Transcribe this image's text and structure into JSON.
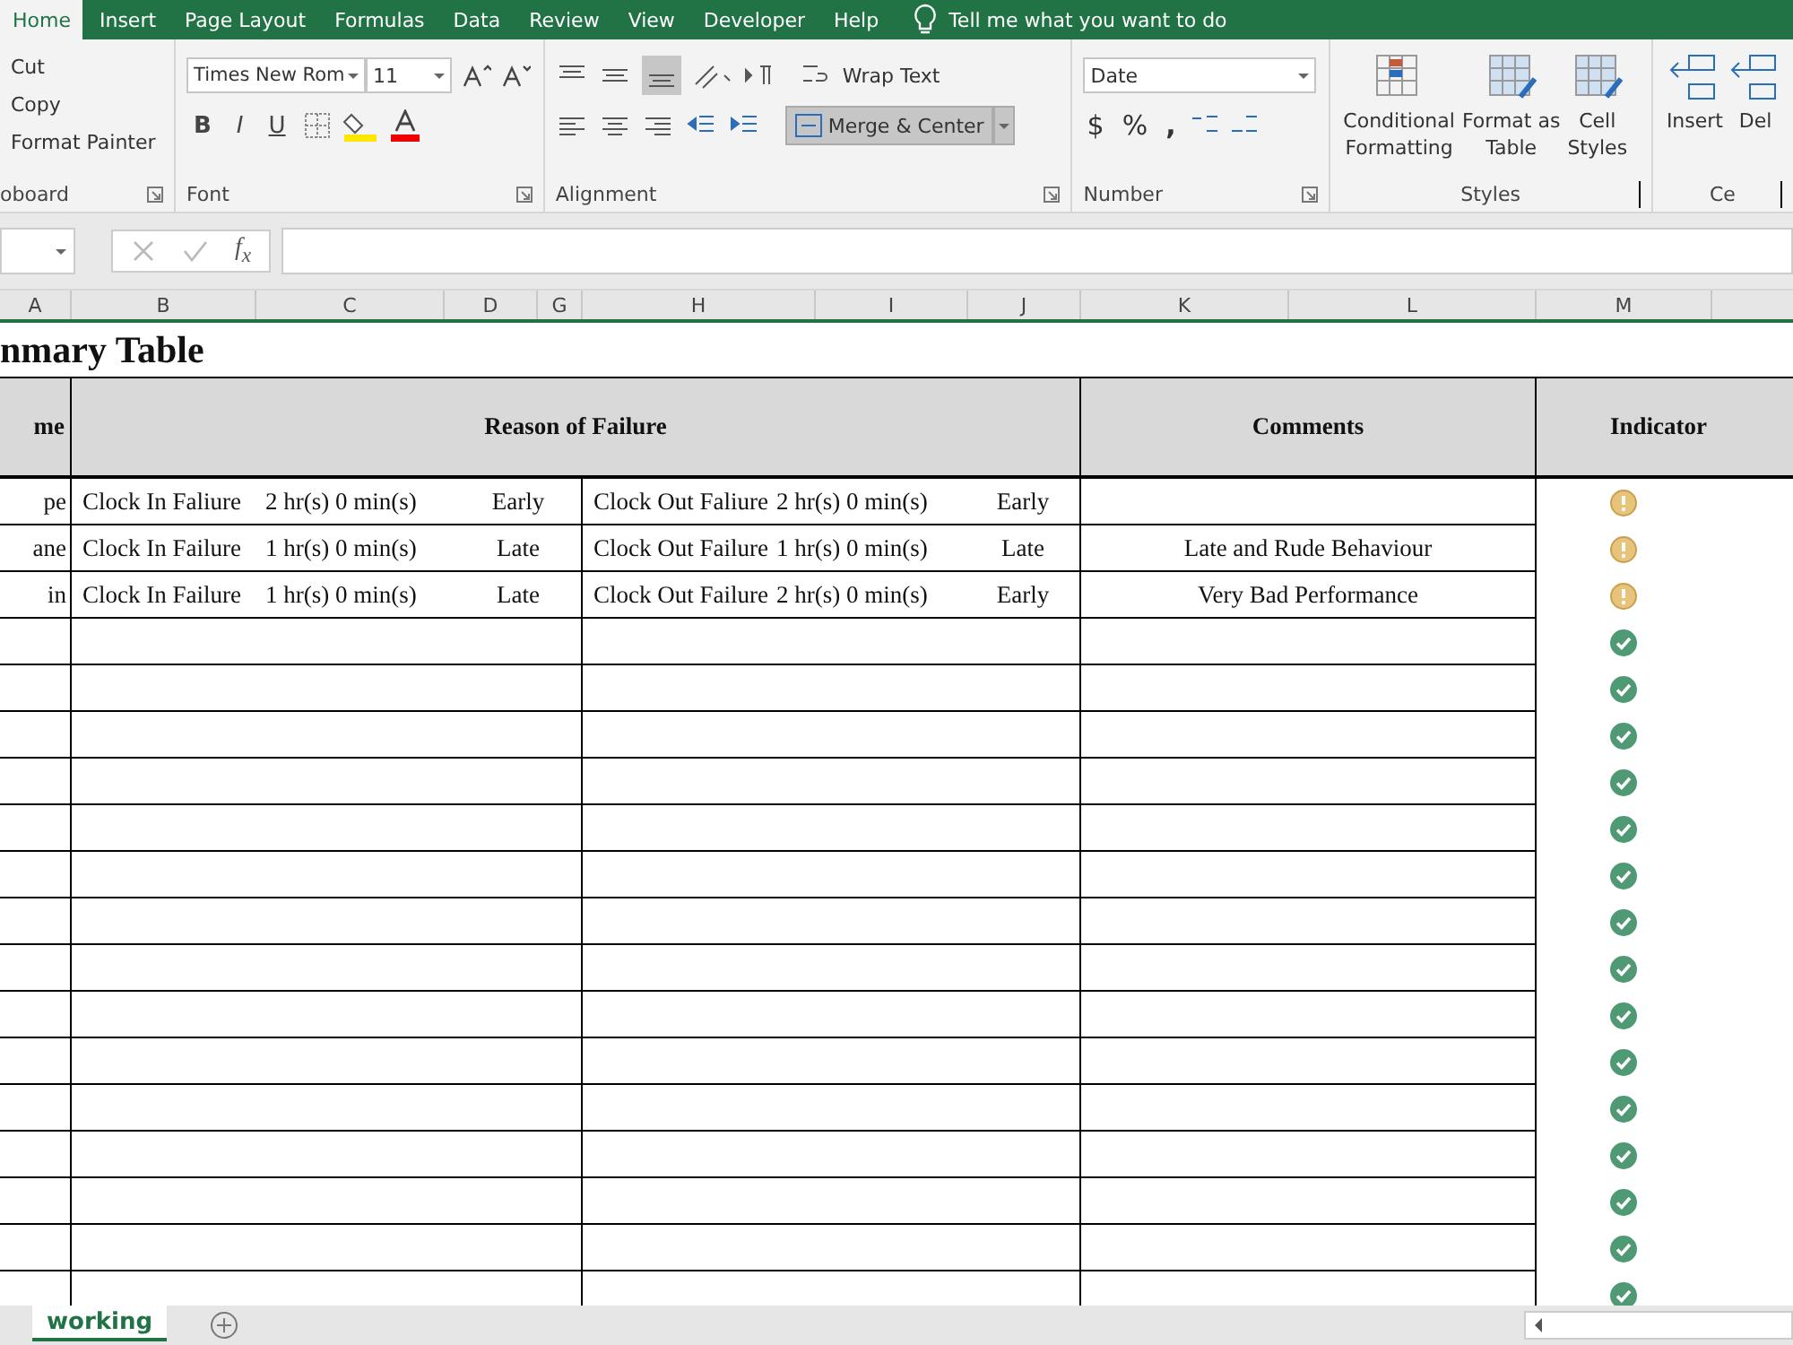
{
  "ribbon_tabs": [
    {
      "label": "Home",
      "selected": true
    },
    {
      "label": "Insert",
      "selected": false
    },
    {
      "label": "Page Layout",
      "selected": false
    },
    {
      "label": "Formulas",
      "selected": false
    },
    {
      "label": "Data",
      "selected": false
    },
    {
      "label": "Review",
      "selected": false
    },
    {
      "label": "View",
      "selected": false
    },
    {
      "label": "Developer",
      "selected": false
    },
    {
      "label": "Help",
      "selected": false
    }
  ],
  "tell_me": "Tell me what you want to do",
  "clipboard": {
    "items": [
      "Cut",
      "Copy",
      "Format Painter"
    ],
    "label": "oboard"
  },
  "font": {
    "family": "Times New Rom",
    "size": "11",
    "bold": "B",
    "italic": "I",
    "underline": "U",
    "label": "Font"
  },
  "alignment": {
    "wrap": "Wrap Text",
    "merge": "Merge & Center",
    "label": "Alignment"
  },
  "number": {
    "format": "Date",
    "currency": "$",
    "percent": "%",
    "comma": ",",
    "label": "Number"
  },
  "styles": {
    "buttons": [
      [
        "Conditional",
        "Formatting"
      ],
      [
        "Format as",
        "Table"
      ],
      [
        "Cell",
        "Styles"
      ]
    ],
    "label": "Styles"
  },
  "cells": {
    "buttons": [
      "Insert",
      "Del"
    ],
    "label": "Ce"
  },
  "formula_bar": {
    "fx": "f$_{x}$"
  },
  "columns": [
    "A",
    "B",
    "C",
    "D",
    "G",
    "H",
    "I",
    "J",
    "K",
    "L",
    "M"
  ],
  "sheet": {
    "title": "nmary Table",
    "headers": [
      "me",
      "Reason of Failure",
      "Comments",
      "Indicator"
    ],
    "rows": [
      {
        "name": "pe",
        "clock_in": [
          "Clock In Faliure",
          "2 hr(s) 0 min(s)",
          "Early"
        ],
        "clock_out": [
          "Clock Out Faliure",
          "2 hr(s) 0 min(s)",
          "Early"
        ],
        "kind": "warning"
      },
      {
        "name": "ane",
        "clock_in": [
          "Clock In Failure",
          "1 hr(s) 0 min(s)",
          "Late"
        ],
        "clock_out": [
          "Clock Out Failure",
          "1 hr(s) 0 min(s)",
          "Late"
        ],
        "comment": "Late and Rude Behaviour",
        "kind": "warning"
      },
      {
        "name": "in",
        "clock_in": [
          "Clock In Failure",
          "1 hr(s) 0 min(s)",
          "Late"
        ],
        "clock_out": [
          "Clock Out Failure",
          "2 hr(s) 0 min(s)",
          "Early"
        ],
        "comment": "Very Bad Performance",
        "kind": "warning"
      },
      {
        "kind": "ok"
      },
      {
        "kind": "ok"
      },
      {
        "kind": "ok"
      },
      {
        "kind": "ok"
      },
      {
        "kind": "ok"
      },
      {
        "kind": "ok"
      },
      {
        "kind": "ok"
      },
      {
        "kind": "ok"
      },
      {
        "kind": "ok"
      },
      {
        "kind": "ok"
      },
      {
        "kind": "ok"
      },
      {
        "kind": "ok"
      },
      {
        "kind": "ok"
      },
      {
        "kind": "ok"
      },
      {
        "kind": "ok"
      }
    ]
  },
  "sheet_tabs": [
    {
      "label": "working",
      "selected": true
    }
  ]
}
